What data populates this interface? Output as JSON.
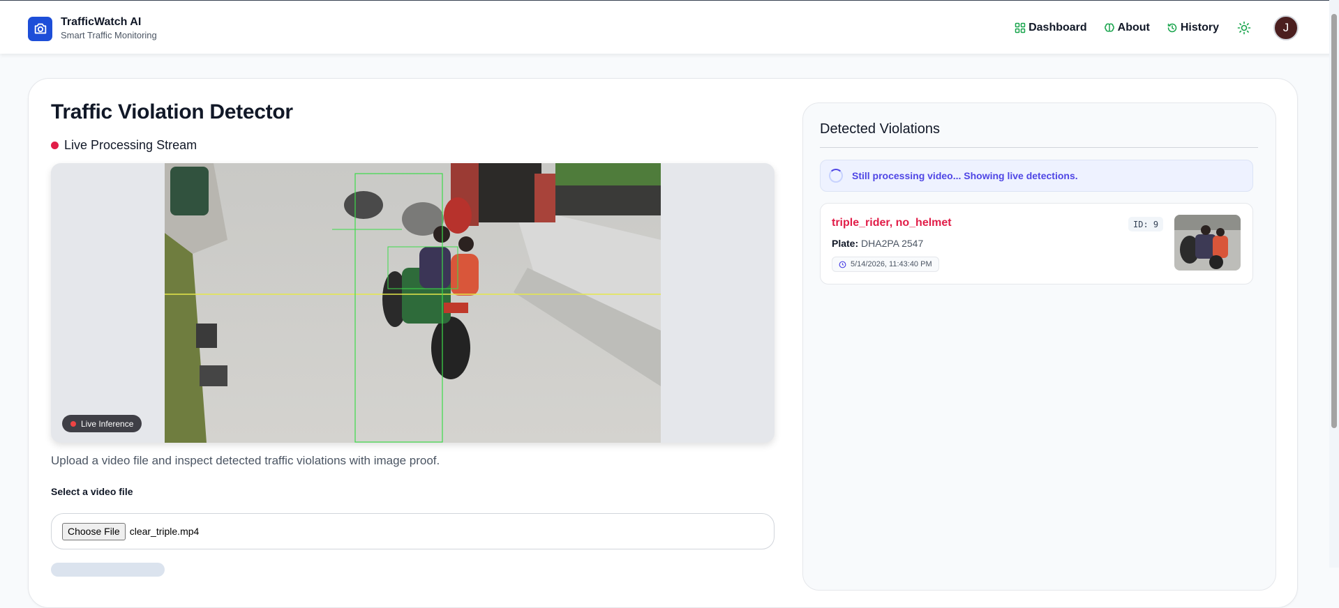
{
  "header": {
    "brand_title": "TrafficWatch AI",
    "brand_subtitle": "Smart Traffic Monitoring",
    "logo_icon": "camera-icon",
    "nav": [
      {
        "label": "Dashboard",
        "icon": "grid-icon"
      },
      {
        "label": "About",
        "icon": "brain-icon"
      },
      {
        "label": "History",
        "icon": "history-icon"
      }
    ],
    "theme_icon": "sun-icon",
    "avatar_initial": "J"
  },
  "main": {
    "title": "Traffic Violation Detector",
    "stream_label": "Live Processing Stream",
    "live_badge": "Live Inference",
    "description": "Upload a video file and inspect detected traffic violations with image proof.",
    "file_label": "Select a video file",
    "choose_button": "Choose File",
    "file_name": "clear_triple.mp4"
  },
  "panel": {
    "title": "Detected Violations",
    "status": "Still processing video... Showing live detections.",
    "violations": [
      {
        "type": "triple_rider, no_helmet",
        "id_label": "ID: 9",
        "plate_label": "Plate:",
        "plate": "DHA2PA 2547",
        "timestamp": "5/14/2026, 11:43:40 PM"
      }
    ]
  },
  "colors": {
    "brand": "#1d4ed8",
    "accent_green": "#16a34a",
    "alert_red": "#e11d48",
    "info_indigo": "#4f46e5"
  }
}
